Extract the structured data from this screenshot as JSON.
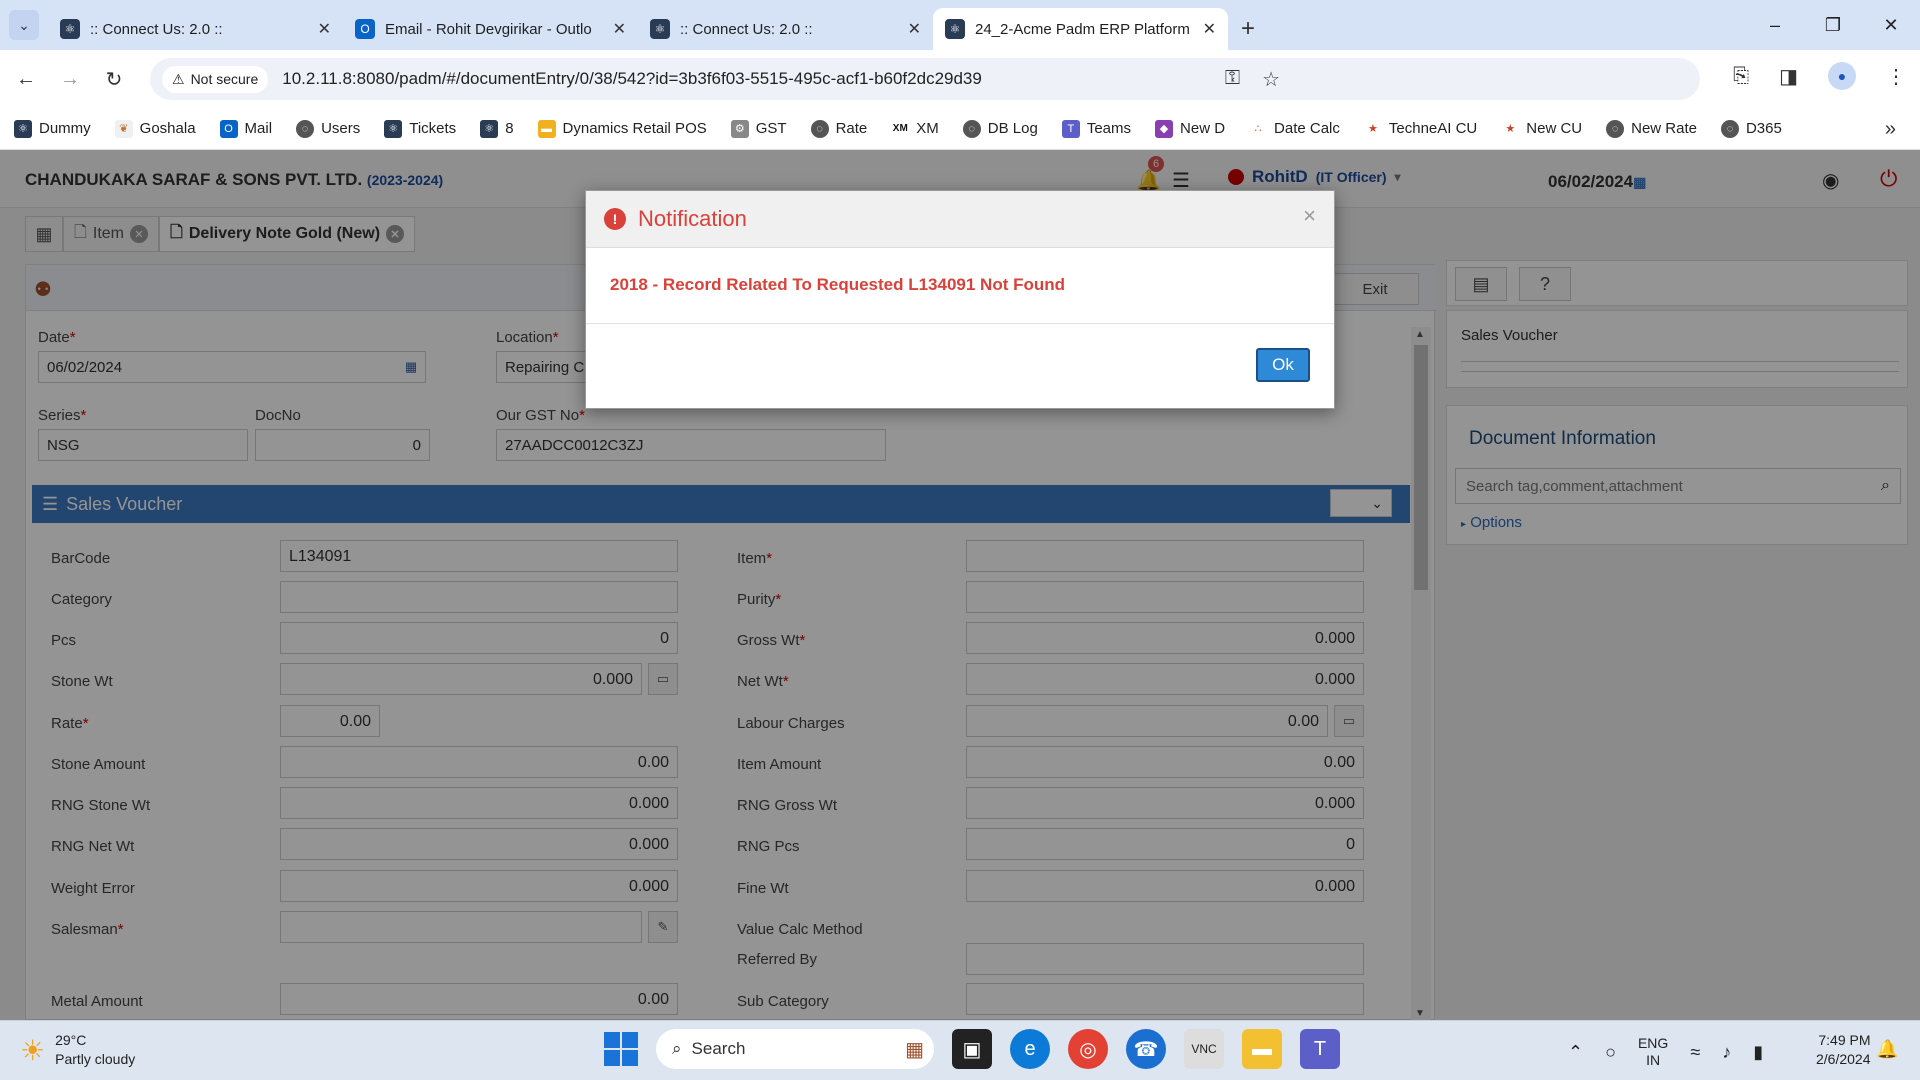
{
  "browser": {
    "tabs": [
      {
        "title": ":: Connect Us: 2.0 ::",
        "active": false
      },
      {
        "title": "Email - Rohit Devgirikar - Outlo",
        "active": false
      },
      {
        "title": ":: Connect Us: 2.0 ::",
        "active": false
      },
      {
        "title": "24_2-Acme Padm ERP Platform",
        "active": true
      }
    ],
    "security_label": "Not secure",
    "url": "10.2.11.8:8080/padm/#/documentEntry/0/38/542?id=3b3f6f03-5515-495c-acf1-b60f2dc29d39",
    "bookmarks": [
      "Dummy",
      "Goshala",
      "Mail",
      "Users",
      "Tickets",
      "8",
      "Dynamics Retail POS",
      "GST",
      "Rate",
      "XM",
      "DB Log",
      "Teams",
      "New D",
      "Date Calc",
      "TechneAI CU",
      "New CU",
      "New Rate",
      "D365"
    ],
    "bookmark_icon_text": {
      "xm": "XM"
    }
  },
  "app": {
    "company": "CHANDUKAKA SARAF & SONS PVT. LTD.",
    "year": "(2023-2024)",
    "notification_count": "6",
    "user": "RohitD",
    "role": "(IT Officer)",
    "header_date": "06/02/2024",
    "tabs": [
      {
        "label": "Item",
        "active": false
      },
      {
        "label": "Delivery Note Gold (New)",
        "active": true
      }
    ],
    "exit_label": "Exit"
  },
  "form": {
    "date_label": "Date",
    "date_value": "06/02/2024",
    "location_label": "Location",
    "location_value": "Repairing Co",
    "series_label": "Series",
    "series_value": "NSG",
    "docno_label": "DocNo",
    "docno_value": "0",
    "gst_label": "Our GST No",
    "gst_value": "27AADCC0012C3ZJ",
    "section_title": "Sales Voucher",
    "left_fields": [
      {
        "label": "BarCode",
        "value": "L134091",
        "required": false
      },
      {
        "label": "Category",
        "value": "",
        "required": false
      },
      {
        "label": "Pcs",
        "value": "0",
        "required": false
      },
      {
        "label": "Stone Wt",
        "value": "0.000",
        "required": false
      },
      {
        "label": "Rate",
        "value": "0.00",
        "required": true
      },
      {
        "label": "Stone Amount",
        "value": "0.00",
        "required": false
      },
      {
        "label": "RNG Stone Wt",
        "value": "0.000",
        "required": false
      },
      {
        "label": "RNG Net Wt",
        "value": "0.000",
        "required": false
      },
      {
        "label": "Weight Error",
        "value": "0.000",
        "required": false
      },
      {
        "label": "Salesman",
        "value": "",
        "required": true
      },
      {
        "label": "Metal Amount",
        "value": "0.00",
        "required": false
      }
    ],
    "right_fields": [
      {
        "label": "Item",
        "value": "",
        "required": true
      },
      {
        "label": "Purity",
        "value": "",
        "required": true
      },
      {
        "label": "Gross Wt",
        "value": "0.000",
        "required": true
      },
      {
        "label": "Net Wt",
        "value": "0.000",
        "required": true
      },
      {
        "label": "Labour Charges",
        "value": "0.00",
        "required": false
      },
      {
        "label": "Item Amount",
        "value": "0.00",
        "required": false
      },
      {
        "label": "RNG Gross Wt",
        "value": "0.000",
        "required": false
      },
      {
        "label": "RNG Pcs",
        "value": "0",
        "required": false
      },
      {
        "label": "Fine Wt",
        "value": "0.000",
        "required": false
      },
      {
        "label": "Value Calc Method",
        "value": "",
        "required": false
      },
      {
        "label": "Referred By",
        "value": "",
        "required": false
      },
      {
        "label": "Sub Category",
        "value": "",
        "required": false
      }
    ]
  },
  "side": {
    "voucher_title": "Sales Voucher",
    "doc_info_title": "Document Information",
    "search_placeholder": "Search tag,comment,attachment",
    "options_label": "Options"
  },
  "modal": {
    "title": "Notification",
    "message": "2018 - Record Related To Requested L134091 Not Found",
    "ok_label": "Ok"
  },
  "taskbar": {
    "temperature": "29°C",
    "weather": "Partly cloudy",
    "search_label": "Search",
    "lang_1": "ENG",
    "lang_2": "IN",
    "time": "7:49 PM",
    "date": "2/6/2024"
  },
  "colors": {
    "accent": "#3c79c2",
    "error": "#d9423a",
    "ok_button": "#2e8ad6"
  }
}
